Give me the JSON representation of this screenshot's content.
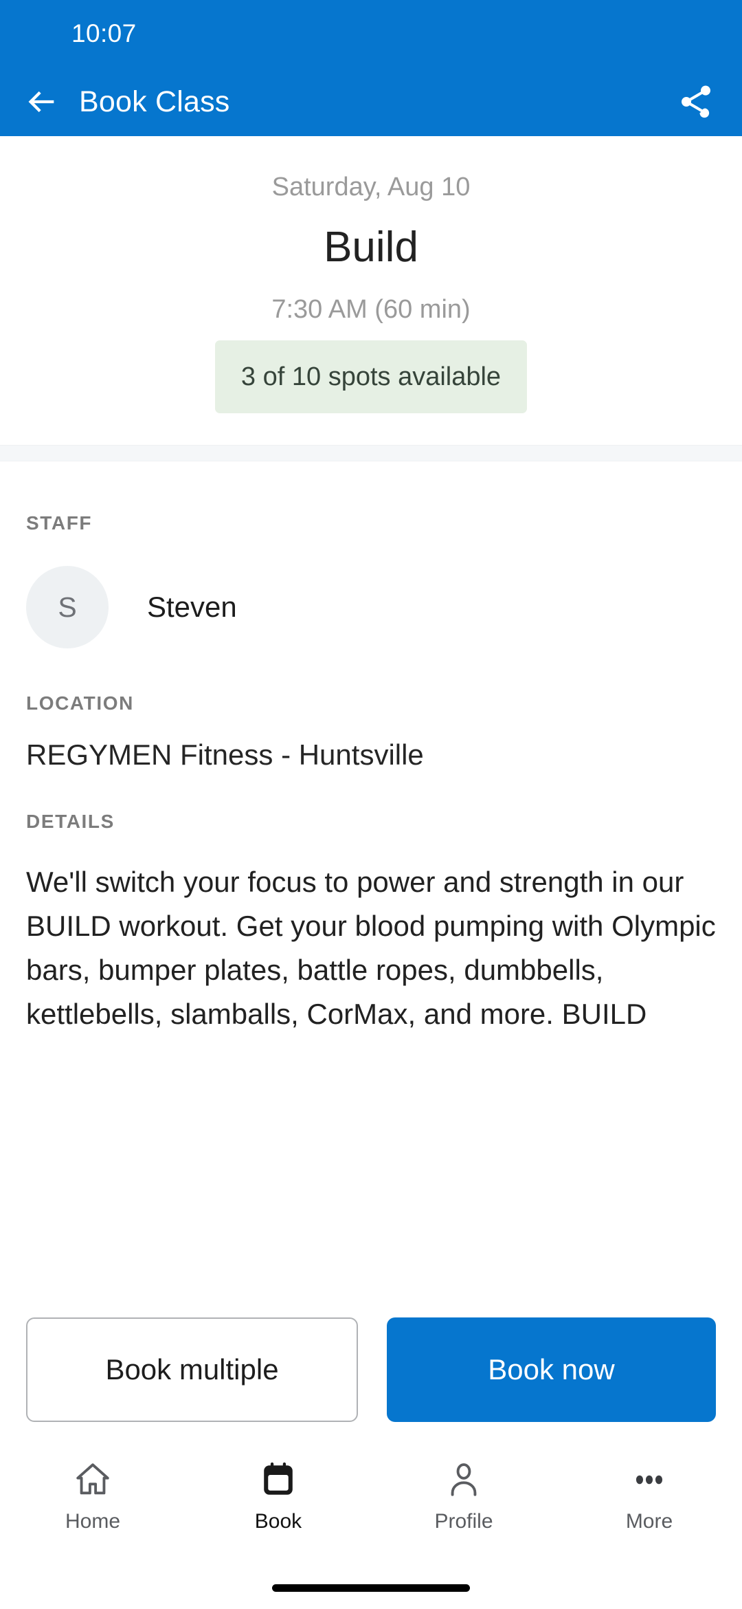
{
  "status_bar": {
    "time": "10:07"
  },
  "app_bar": {
    "title": "Book Class",
    "back_icon": "arrow-left-icon",
    "share_icon": "share-icon",
    "background_color": "#0676CE"
  },
  "class_summary": {
    "date": "Saturday, Aug 10",
    "name": "Build",
    "time": "7:30 AM (60 min)",
    "availability": "3 of 10 spots available",
    "availability_bg_color": "#E6F0E4",
    "availability_text_color": "#36443A"
  },
  "staff": {
    "label": "STAFF",
    "avatar_initial": "S",
    "name": "Steven"
  },
  "location": {
    "label": "LOCATION",
    "value": "REGYMEN Fitness - Huntsville"
  },
  "details": {
    "label": "DETAILS",
    "text": "We'll switch your focus to power and strength in our BUILD workout. Get your blood pumping with Olympic bars, bumper plates, battle ropes, dumbbells, kettlebells, slamballs, CorMax, and more. BUILD"
  },
  "actions": {
    "secondary_label": "Book multiple",
    "primary_label": "Book now",
    "primary_color": "#0676CE"
  },
  "bottom_nav": {
    "items": [
      {
        "label": "Home",
        "icon": "home-icon",
        "active": false
      },
      {
        "label": "Book",
        "icon": "calendar-icon",
        "active": true
      },
      {
        "label": "Profile",
        "icon": "person-icon",
        "active": false
      },
      {
        "label": "More",
        "icon": "ellipsis-icon",
        "active": false
      }
    ]
  }
}
